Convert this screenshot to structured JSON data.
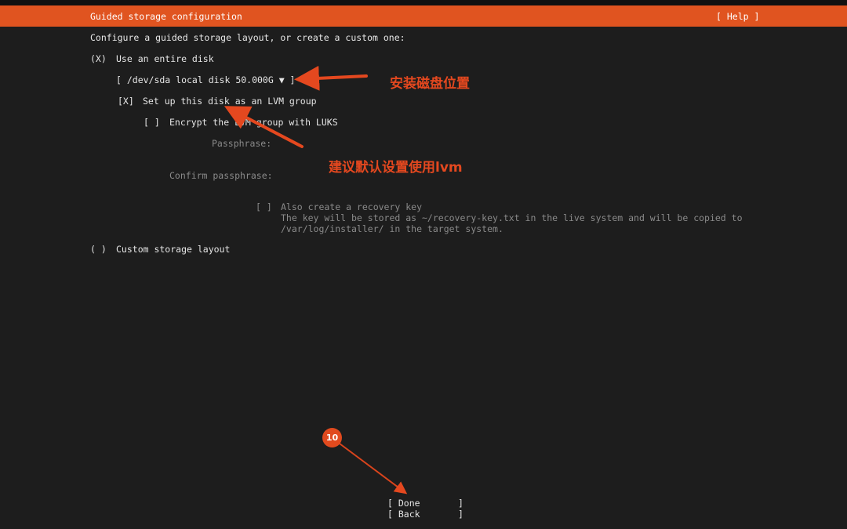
{
  "header": {
    "title": "Guided storage configuration",
    "help": "[ Help ]"
  },
  "intro": "Configure a guided storage layout, or create a custom one:",
  "entire_disk": {
    "radio": "(X)",
    "label": "Use an entire disk"
  },
  "disk_select": {
    "value": "[ /dev/sda local disk 50.000G ▼ ]"
  },
  "lvm": {
    "checkbox": "[X]",
    "label": "Set up this disk as an LVM group"
  },
  "encrypt": {
    "checkbox": "[ ]",
    "label": "Encrypt the LVM group with LUKS"
  },
  "passphrase_label": "Passphrase:",
  "confirm_label": "Confirm passphrase:",
  "recovery": {
    "checkbox": "[ ]",
    "label": "Also create a recovery key",
    "desc1": "The key will be stored as ~/recovery-key.txt in the live system and will be copied to",
    "desc2": "/var/log/installer/ in the target system."
  },
  "custom": {
    "radio": "( )",
    "label": "Custom storage layout"
  },
  "buttons": {
    "done": "[ Done       ]",
    "back": "[ Back       ]"
  },
  "annotations": {
    "disk_location": "安装磁盘位置",
    "lvm_hint": "建议默认设置使用lvm",
    "step": "10"
  },
  "colors": {
    "accent": "#e05420",
    "annotation": "#e4481f",
    "background": "#1d1d1d"
  }
}
